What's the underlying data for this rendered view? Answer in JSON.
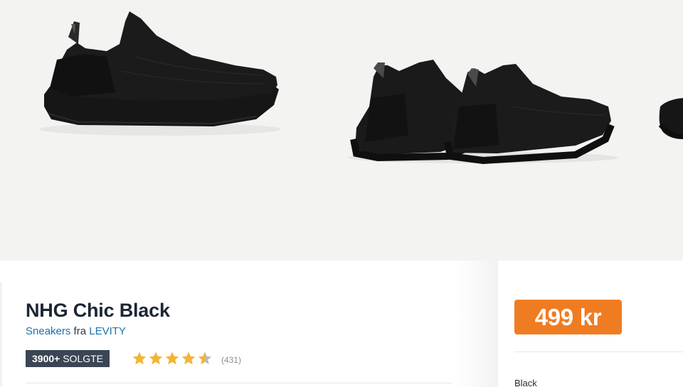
{
  "gallery": {
    "images": [
      {
        "alt": "shoe-side-view"
      },
      {
        "alt": "shoe-pair-back-view"
      },
      {
        "alt": "shoe-partial-view"
      }
    ]
  },
  "product": {
    "title": "NHG Chic Black",
    "category": "Sneakers",
    "from_word": "fra",
    "brand": "LEVITY",
    "sold_count": "3900+",
    "sold_label": "SOLGTE",
    "rating": 4.5,
    "rating_max": 5,
    "review_count": "(431)",
    "price": "499 kr",
    "color": "Black"
  },
  "colors": {
    "price_badge": "#f07c22",
    "sold_badge": "#3b4554",
    "star_filled": "#f5b431",
    "star_empty": "#b8bcc2",
    "link": "#1a73a8"
  },
  "icons": {
    "star": "star-icon"
  }
}
